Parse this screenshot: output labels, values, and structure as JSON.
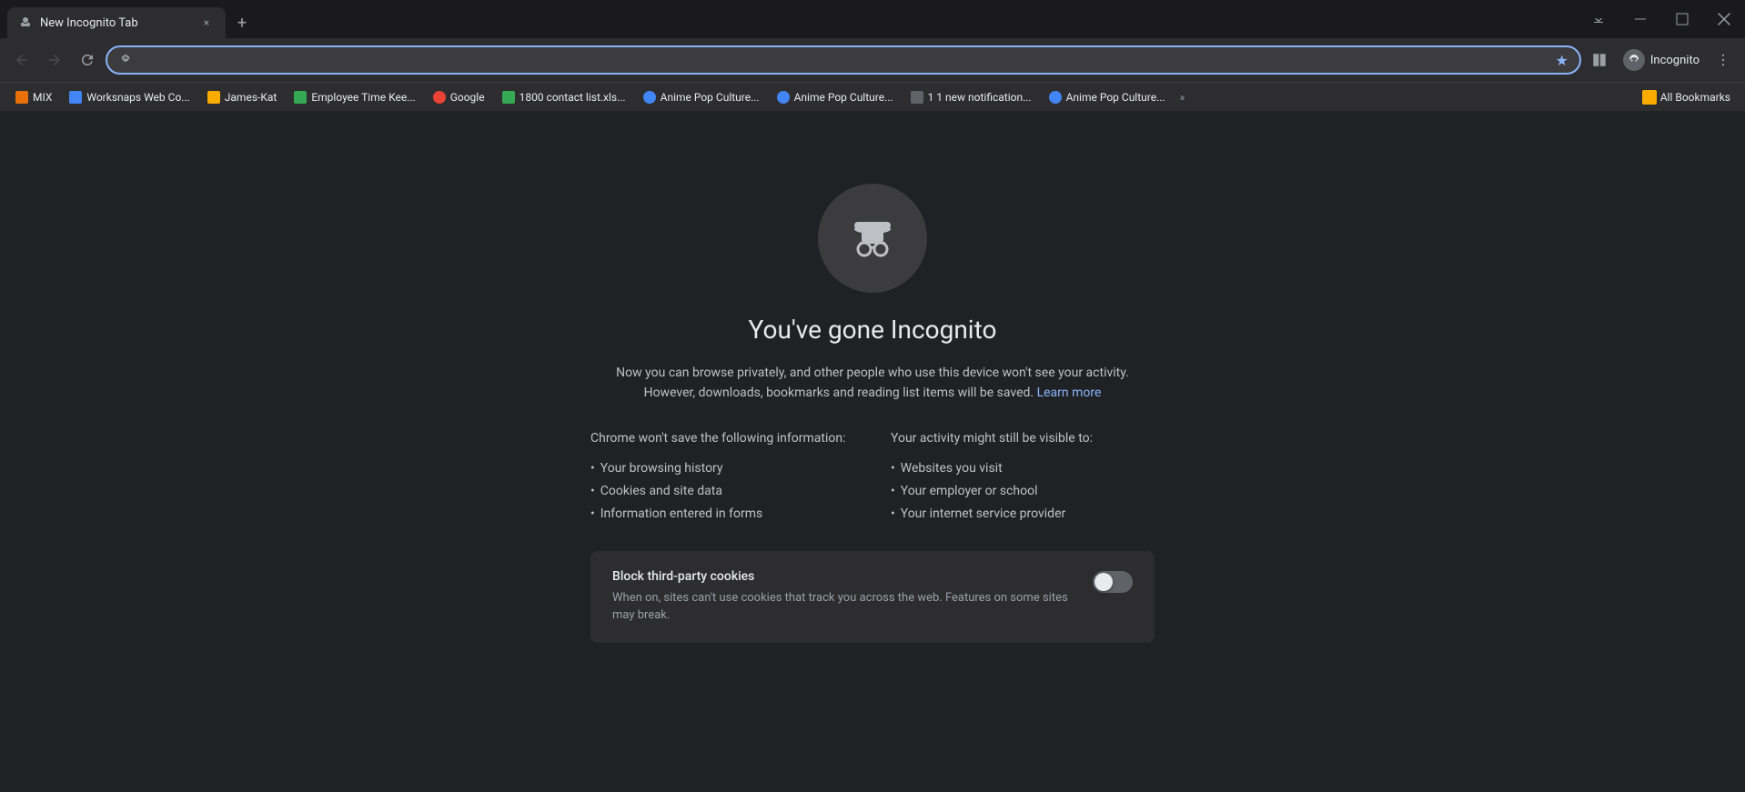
{
  "window": {
    "title": "New Incognito Tab",
    "controls": {
      "minimize": "─",
      "maximize": "□",
      "close": "✕"
    }
  },
  "tab": {
    "title": "New Incognito Tab",
    "close_label": "×"
  },
  "new_tab_btn": "+",
  "nav": {
    "back_disabled": true,
    "forward_disabled": true,
    "reload_label": "↺",
    "address": "",
    "address_placeholder": "",
    "bookmark_star": "★"
  },
  "bookmarks": [
    {
      "id": "mix",
      "label": "MIX",
      "color": "bm-mix"
    },
    {
      "id": "worksnaps",
      "label": "Worksnaps Web Co...",
      "color": "bm-worksnaps"
    },
    {
      "id": "james",
      "label": "James-Kat",
      "color": "bm-james"
    },
    {
      "id": "employee",
      "label": "Employee Time Kee...",
      "color": "bm-employee"
    },
    {
      "id": "google",
      "label": "Google",
      "color": "bm-google"
    },
    {
      "id": "1800",
      "label": "1800 contact list.xls...",
      "color": "bm-1800"
    },
    {
      "id": "anime1",
      "label": "Anime Pop Culture...",
      "color": "bm-anime1"
    },
    {
      "id": "anime2",
      "label": "Anime Pop Culture...",
      "color": "bm-anime2"
    },
    {
      "id": "notif",
      "label": "1 1 new notification...",
      "color": "bm-notif"
    },
    {
      "id": "anime3",
      "label": "Anime Pop Culture...",
      "color": "bm-anime3"
    }
  ],
  "bookmarks_more": "»",
  "all_bookmarks_label": "All Bookmarks",
  "profile": {
    "label": "Incognito",
    "avatar_char": "👤"
  },
  "page": {
    "icon_alt": "Incognito spy icon",
    "title": "You've gone Incognito",
    "description_part1": "Now you can browse privately, and other people who use this device won't see your activity. However, downloads, bookmarks and reading list items will be saved.",
    "learn_more_label": "Learn more",
    "learn_more_url": "#",
    "col_left_title": "Chrome won't save the following information:",
    "col_left_items": [
      "Your browsing history",
      "Cookies and site data",
      "Information entered in forms"
    ],
    "col_right_title": "Your activity might still be visible to:",
    "col_right_items": [
      "Websites you visit",
      "Your employer or school",
      "Your internet service provider"
    ],
    "cookie_box": {
      "title": "Block third-party cookies",
      "description": "When on, sites can't use cookies that track you across the web. Features on some sites may break.",
      "toggle_on": false
    }
  }
}
